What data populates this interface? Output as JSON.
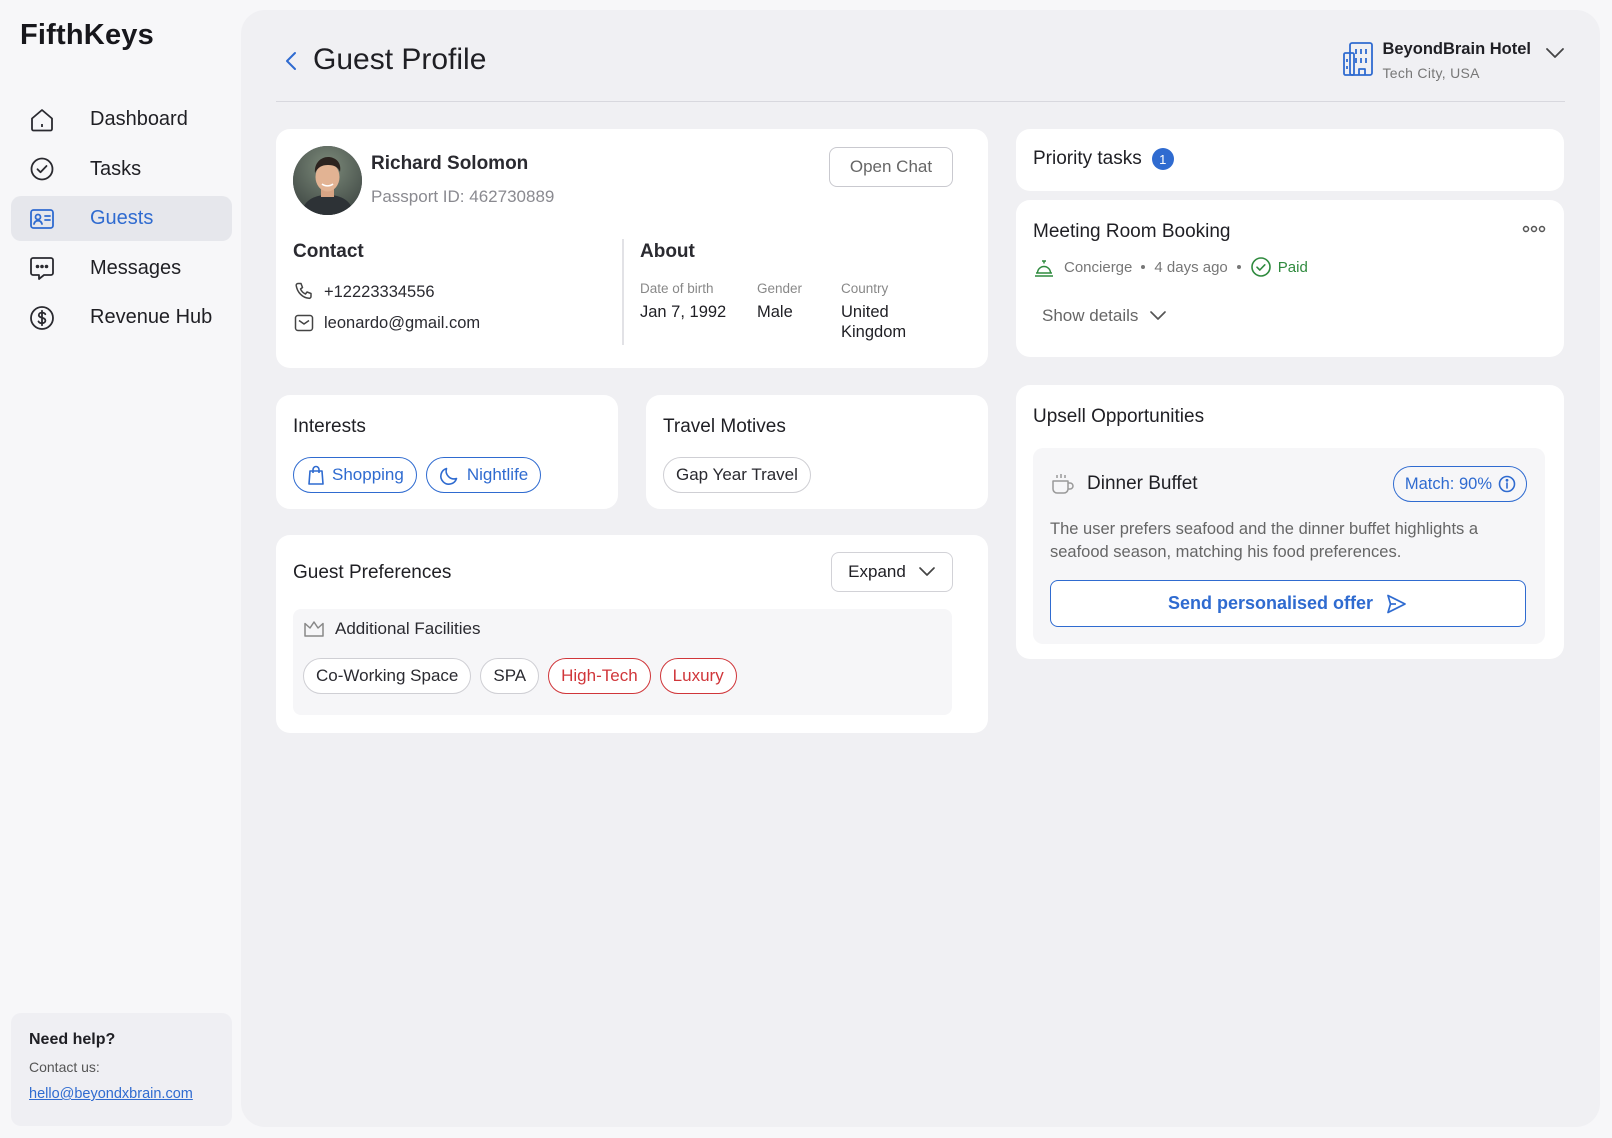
{
  "app": {
    "name": "FifthKeys"
  },
  "sidebar": {
    "items": [
      {
        "label": "Dashboard",
        "icon": "home-icon"
      },
      {
        "label": "Tasks",
        "icon": "check-circle-icon"
      },
      {
        "label": "Guests",
        "icon": "id-card-icon",
        "active": true
      },
      {
        "label": "Messages",
        "icon": "chat-bubble-icon"
      },
      {
        "label": "Revenue Hub",
        "icon": "dollar-circle-icon"
      }
    ],
    "help": {
      "title": "Need help?",
      "subtitle": "Contact us:",
      "email": "hello@beyondxbrain.com"
    }
  },
  "header": {
    "title": "Guest Profile",
    "hotel": {
      "name": "BeyondBrain Hotel",
      "location": "Tech City, USA"
    }
  },
  "guest": {
    "name": "Richard Solomon",
    "passport": "Passport ID: 462730889",
    "open_chat_label": "Open Chat",
    "contact": {
      "title": "Contact",
      "phone": "+12223334556",
      "email": "leonardo@gmail.com"
    },
    "about": {
      "title": "About",
      "dob_label": "Date of birth",
      "dob": "Jan 7, 1992",
      "gender_label": "Gender",
      "gender": "Male",
      "country_label": "Country",
      "country": "United Kingdom"
    }
  },
  "interests": {
    "title": "Interests",
    "items": [
      {
        "label": "Shopping",
        "icon": "shopping-bag-icon"
      },
      {
        "label": "Nightlife",
        "icon": "moon-icon"
      }
    ]
  },
  "travel_motives": {
    "title": "Travel Motives",
    "items": [
      "Gap Year Travel"
    ]
  },
  "preferences": {
    "title": "Guest Preferences",
    "expand_label": "Expand",
    "group_title": "Additional Facilities",
    "tags": [
      {
        "label": "Co-Working Space",
        "style": "neutral"
      },
      {
        "label": "SPA",
        "style": "neutral"
      },
      {
        "label": "High-Tech",
        "style": "red"
      },
      {
        "label": "Luxury",
        "style": "red"
      }
    ]
  },
  "priority_tasks": {
    "title": "Priority tasks",
    "count": "1",
    "task": {
      "title": "Meeting Room Booking",
      "department": "Concierge",
      "time": "4 days ago",
      "status": "Paid",
      "show_details_label": "Show details"
    }
  },
  "upsell": {
    "title": "Upsell Opportunities",
    "item": {
      "title": "Dinner Buffet",
      "match": "Match: 90%",
      "description": "The user prefers seafood and the dinner buffet highlights a seafood season, matching his food preferences.",
      "cta": "Send personalised offer"
    }
  },
  "colors": {
    "accent": "#2f6bd0",
    "danger": "#d0363a",
    "success": "#2f8a3e",
    "background": "#f0f0f3"
  }
}
